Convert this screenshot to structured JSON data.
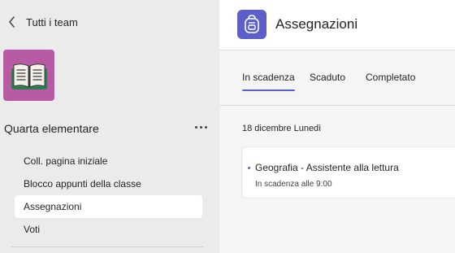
{
  "sidebar": {
    "back_label": "Tutti i team",
    "team_name": "Quarta elementare",
    "nav_items": [
      {
        "label": "Coll. pagina iniziale",
        "active": false
      },
      {
        "label": "Blocco appunti della classe",
        "active": false
      },
      {
        "label": "Assegnazioni",
        "active": true
      },
      {
        "label": "Voti",
        "active": false
      }
    ]
  },
  "header": {
    "title": "Assegnazioni",
    "icon": "backpack-icon"
  },
  "tabs": [
    {
      "label": "In scadenza",
      "active": true
    },
    {
      "label": "Scaduto",
      "active": false
    },
    {
      "label": "Completato",
      "active": false
    }
  ],
  "assignments": {
    "date_heading": "18 dicembre  Lunedì",
    "items": [
      {
        "title": "Geografia - Assistente alla lettura",
        "due": "In scadenza alle 9:00"
      }
    ]
  },
  "colors": {
    "accent": "#5b5fc7",
    "team_logo_bg": "#b85aa4",
    "book_cover": "#2e7d4f"
  }
}
